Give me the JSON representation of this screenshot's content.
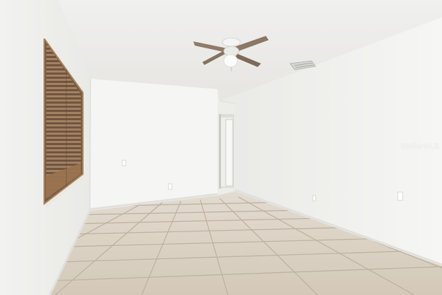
{
  "scene": {
    "watermark": "StellarMLS",
    "colors": {
      "ceiling": "#eeeeec",
      "left_wall": "#f4f4f2",
      "back_wall": "#f7f7f5",
      "right_wall": "#f3f3f1",
      "floor_tile": "#d9cfc1",
      "grout": "#b7ab99",
      "blinds": "#8a6a4e",
      "window_frame": "#9c7a55",
      "fan_blade": "#8b7765"
    },
    "objects": [
      "ceiling-fan",
      "window-with-blinds",
      "doorway",
      "tile-floor",
      "air-vent",
      "outlets"
    ]
  }
}
